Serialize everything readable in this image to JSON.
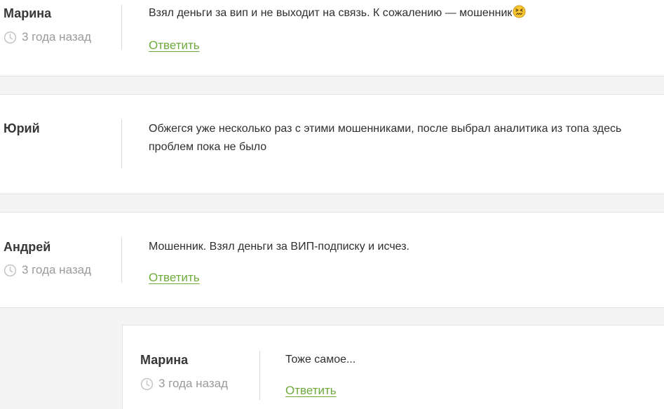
{
  "comments": [
    {
      "author": "Марина",
      "time": "3 года назад",
      "text_lines": [
        "Взял деньги за вип и не выходит на связь. К сожалению — мошенник"
      ],
      "emoji_icon": "confounded-face-emoji",
      "reply_label": "Ответить"
    },
    {
      "author": "Юрий",
      "text_lines": [
        "Обжегся уже несколько раз с этими мошенниками, после выбрал аналитика из топа здесь",
        "проблем пока не было"
      ]
    },
    {
      "author": "Андрей",
      "time": "3 года назад",
      "text_lines": [
        "Мошенник. Взял деньги за ВИП-подписку и исчез."
      ],
      "reply_label": "Ответить"
    },
    {
      "author": "Марина",
      "time": "3 года назад",
      "text_lines": [
        "Тоже самое..."
      ],
      "reply_label": "Ответить",
      "is_reply": true
    }
  ],
  "colors": {
    "link": "#6dab3c",
    "muted": "#9a9a9a",
    "background": "#f4f4f4",
    "card": "#ffffff"
  }
}
